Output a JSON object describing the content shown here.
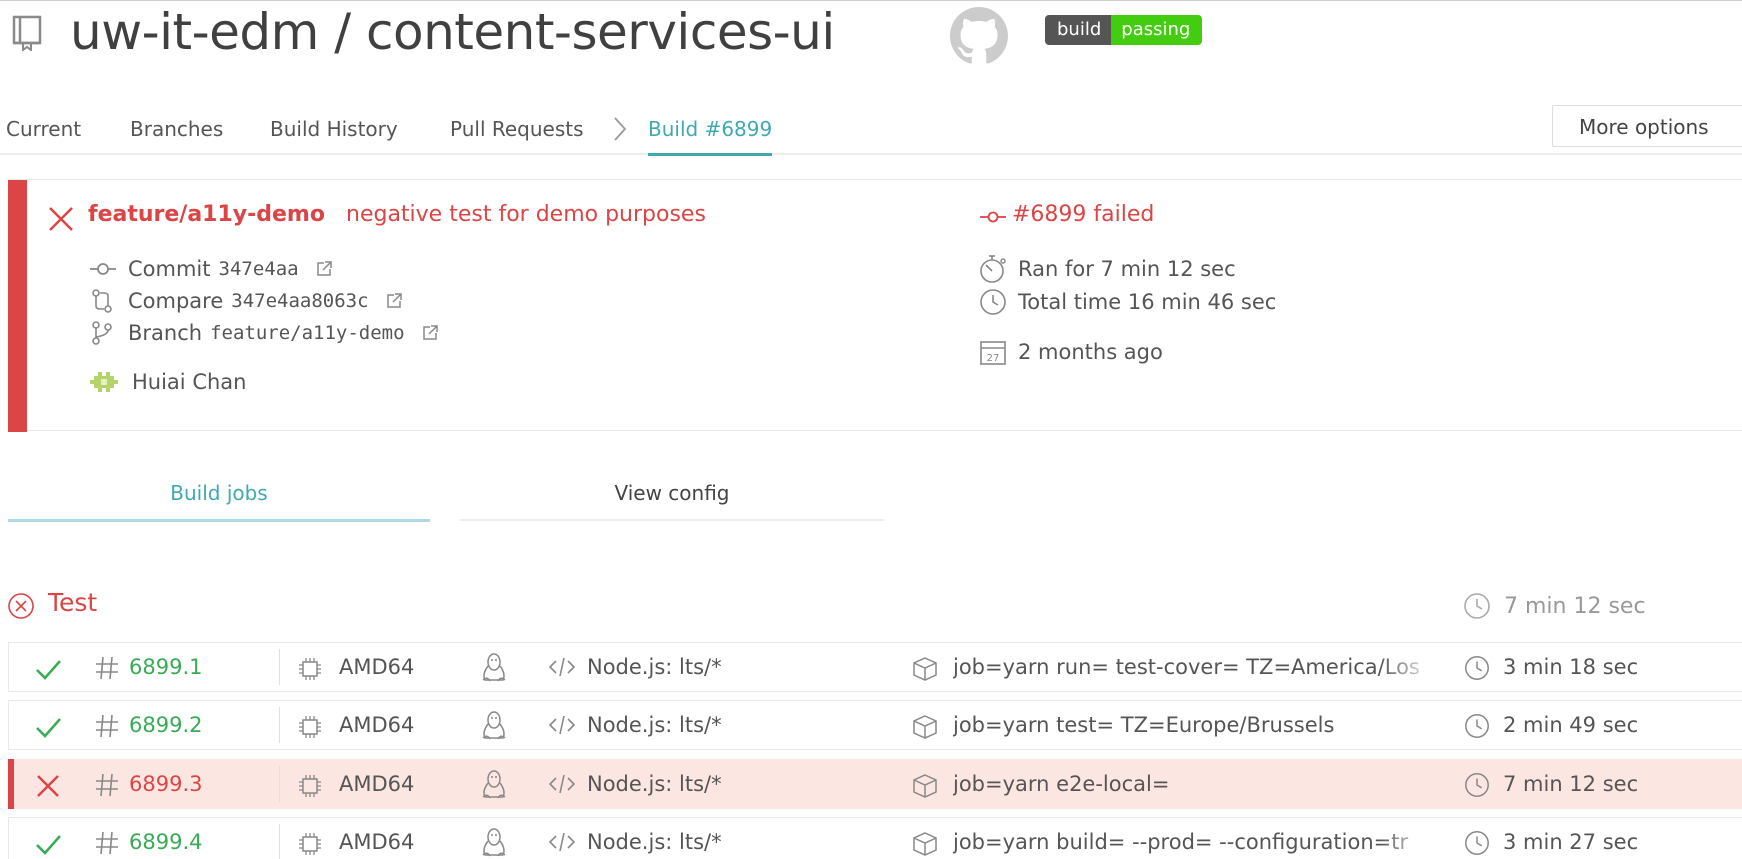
{
  "header": {
    "repo_title": "uw-it-edm / content-services-ui",
    "badge_left": "build",
    "badge_right": "passing"
  },
  "nav": {
    "current": "Current",
    "branches": "Branches",
    "build_history": "Build History",
    "pull_requests": "Pull Requests",
    "active": "Build #6899",
    "more_options": "More options"
  },
  "build": {
    "branch": "feature/a11y-demo",
    "message": "negative test for demo purposes",
    "commit_label": "Commit",
    "commit_sha": "347e4aa",
    "compare_label": "Compare",
    "compare_sha": "347e4aa8063c",
    "branch_label": "Branch",
    "branch_value": "feature/a11y-demo",
    "author": "Huiai Chan",
    "status": "#6899 failed",
    "ran_for": "Ran for 7 min 12 sec",
    "total_time": "Total time 16 min 46 sec",
    "calendar_day": "27",
    "finished": "2 months ago",
    "accent_color": "#db4545"
  },
  "tabs": {
    "build_jobs": "Build jobs",
    "view_config": "View config"
  },
  "stage": {
    "name": "Test",
    "duration": "7 min 12 sec"
  },
  "jobs": [
    {
      "state": "passed",
      "number": "6899.1",
      "arch": "AMD64",
      "os_icon": "linux-icon",
      "lang": "Node.js: lts/*",
      "env": "job=yarn run= test-cover= TZ=America/Los",
      "duration": "3 min 18 sec"
    },
    {
      "state": "passed",
      "number": "6899.2",
      "arch": "AMD64",
      "os_icon": "linux-icon",
      "lang": "Node.js: lts/*",
      "env": "job=yarn test= TZ=Europe/Brussels",
      "duration": "2 min 49 sec"
    },
    {
      "state": "failed",
      "number": "6899.3",
      "arch": "AMD64",
      "os_icon": "linux-icon",
      "lang": "Node.js: lts/*",
      "env": "job=yarn e2e-local=",
      "duration": "7 min 12 sec"
    },
    {
      "state": "passed",
      "number": "6899.4",
      "arch": "AMD64",
      "os_icon": "linux-icon",
      "lang": "Node.js: lts/*",
      "env": "job=yarn build= --prod= --configuration=tr",
      "duration": "3 min 27 sec"
    }
  ]
}
